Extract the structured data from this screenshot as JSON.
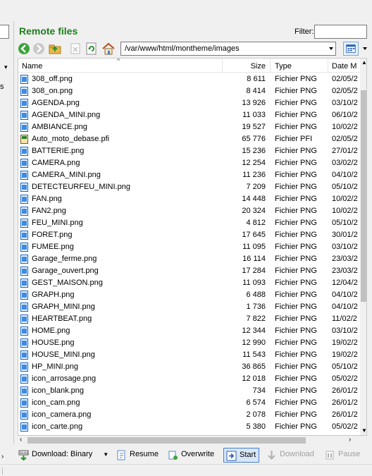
{
  "pane": {
    "title": "Remote files",
    "filter_label": "Filter:",
    "filter_value": "",
    "path": "/var/www/html/montheme/images"
  },
  "left_pane": {
    "partial_text": "s"
  },
  "columns": {
    "name": "Name",
    "size": "Size",
    "type": "Type",
    "date": "Date M"
  },
  "files": [
    {
      "name": "308_off.png",
      "size": "8 611",
      "type": "Fichier PNG",
      "date": "02/05/2",
      "icon": "png-file-icon"
    },
    {
      "name": "308_on.png",
      "size": "8 414",
      "type": "Fichier PNG",
      "date": "02/05/2",
      "icon": "png-file-icon"
    },
    {
      "name": "AGENDA.png",
      "size": "13 926",
      "type": "Fichier PNG",
      "date": "03/10/2",
      "icon": "png-file-icon"
    },
    {
      "name": "AGENDA_MINI.png",
      "size": "11 033",
      "type": "Fichier PNG",
      "date": "06/10/2",
      "icon": "png-file-icon"
    },
    {
      "name": "AMBIANCE.png",
      "size": "19 527",
      "type": "Fichier PNG",
      "date": "10/02/2",
      "icon": "png-file-icon"
    },
    {
      "name": "Auto_moto_debase.pfi",
      "size": "65 776",
      "type": "Fichier PFI",
      "date": "02/05/2",
      "icon": "pfi-file-icon"
    },
    {
      "name": "BATTERIE.png",
      "size": "15 236",
      "type": "Fichier PNG",
      "date": "27/01/2",
      "icon": "png-file-icon"
    },
    {
      "name": "CAMERA.png",
      "size": "12 254",
      "type": "Fichier PNG",
      "date": "03/02/2",
      "icon": "png-file-icon"
    },
    {
      "name": "CAMERA_MINI.png",
      "size": "11 236",
      "type": "Fichier PNG",
      "date": "04/10/2",
      "icon": "png-file-icon"
    },
    {
      "name": "DETECTEURFEU_MINI.png",
      "size": "7 209",
      "type": "Fichier PNG",
      "date": "05/10/2",
      "icon": "png-file-icon"
    },
    {
      "name": "FAN.png",
      "size": "14 448",
      "type": "Fichier PNG",
      "date": "10/02/2",
      "icon": "png-file-icon"
    },
    {
      "name": "FAN2.png",
      "size": "20 324",
      "type": "Fichier PNG",
      "date": "10/02/2",
      "icon": "png-file-icon"
    },
    {
      "name": "FEU_MINI.png",
      "size": "4 812",
      "type": "Fichier PNG",
      "date": "05/10/2",
      "icon": "png-file-icon"
    },
    {
      "name": "FORET.png",
      "size": "17 645",
      "type": "Fichier PNG",
      "date": "30/01/2",
      "icon": "png-file-icon"
    },
    {
      "name": "FUMEE.png",
      "size": "11 095",
      "type": "Fichier PNG",
      "date": "03/10/2",
      "icon": "png-file-icon"
    },
    {
      "name": "Garage_ferme.png",
      "size": "16 114",
      "type": "Fichier PNG",
      "date": "23/03/2",
      "icon": "png-file-icon"
    },
    {
      "name": "Garage_ouvert.png",
      "size": "17 284",
      "type": "Fichier PNG",
      "date": "23/03/2",
      "icon": "png-file-icon"
    },
    {
      "name": "GEST_MAISON.png",
      "size": "11 093",
      "type": "Fichier PNG",
      "date": "12/04/2",
      "icon": "png-file-icon"
    },
    {
      "name": "GRAPH.png",
      "size": "6 488",
      "type": "Fichier PNG",
      "date": "04/10/2",
      "icon": "png-file-icon"
    },
    {
      "name": "GRAPH_MINI.png",
      "size": "1 736",
      "type": "Fichier PNG",
      "date": "04/10/2",
      "icon": "png-file-icon"
    },
    {
      "name": "HEARTBEAT.png",
      "size": "7 822",
      "type": "Fichier PNG",
      "date": "11/02/2",
      "icon": "png-file-icon"
    },
    {
      "name": "HOME.png",
      "size": "12 344",
      "type": "Fichier PNG",
      "date": "03/10/2",
      "icon": "png-file-icon"
    },
    {
      "name": "HOUSE.png",
      "size": "12 990",
      "type": "Fichier PNG",
      "date": "19/02/2",
      "icon": "png-file-icon"
    },
    {
      "name": "HOUSE_MINI.png",
      "size": "11 543",
      "type": "Fichier PNG",
      "date": "19/02/2",
      "icon": "png-file-icon"
    },
    {
      "name": "HP_MINI.png",
      "size": "36 865",
      "type": "Fichier PNG",
      "date": "05/10/2",
      "icon": "png-file-icon"
    },
    {
      "name": "icon_arrosage.png",
      "size": "12 018",
      "type": "Fichier PNG",
      "date": "05/02/2",
      "icon": "png-file-icon"
    },
    {
      "name": "icon_blank.png",
      "size": "734",
      "type": "Fichier PNG",
      "date": "26/01/2",
      "icon": "png-file-icon"
    },
    {
      "name": "icon_cam.png",
      "size": "6 574",
      "type": "Fichier PNG",
      "date": "26/01/2",
      "icon": "png-file-icon"
    },
    {
      "name": "icon_camera.png",
      "size": "2 078",
      "type": "Fichier PNG",
      "date": "26/01/2",
      "icon": "png-file-icon"
    },
    {
      "name": "icon_carte.png",
      "size": "5 380",
      "type": "Fichier PNG",
      "date": "05/02/2",
      "icon": "png-file-icon"
    }
  ],
  "bottom": {
    "download_mode": "Download: Binary",
    "resume": "Resume",
    "overwrite": "Overwrite",
    "start": "Start",
    "download": "Download",
    "pause": "Pause"
  },
  "colors": {
    "title": "#1d7e1d",
    "start_border": "#4a7fd0",
    "icon_blue": "#1b64b8"
  }
}
